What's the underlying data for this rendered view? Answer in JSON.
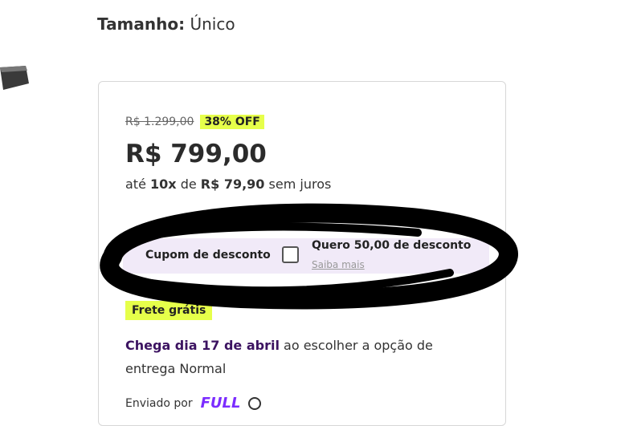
{
  "size": {
    "label": "Tamanho:",
    "value": "Único"
  },
  "pricing": {
    "old_price": "R$ 1.299,00",
    "discount": "38% OFF",
    "price": "R$ 799,00",
    "installments": {
      "prefix": "até",
      "count": "10x",
      "mid": "de",
      "amount": "R$ 79,90",
      "suffix": "sem juros"
    }
  },
  "coupon": {
    "label": "Cupom de desconto",
    "offer": "Quero 50,00 de desconto",
    "more": "Saiba mais",
    "checked": false
  },
  "shipping": {
    "badge": "Frete grátis",
    "arrival_highlight": "Chega dia 17 de abril",
    "arrival_rest": "ao escolher a opção de entrega Normal"
  },
  "bottom": {
    "prefix": "Enviado por",
    "logo_text": "FULL"
  },
  "colors": {
    "badge": "#e6ff4a",
    "highlight": "#3c1361",
    "coupon_bg": "#f1eaf8",
    "full": "#7b2cff"
  },
  "icons": [
    "product-image-edge",
    "checkbox-icon",
    "info-icon"
  ]
}
